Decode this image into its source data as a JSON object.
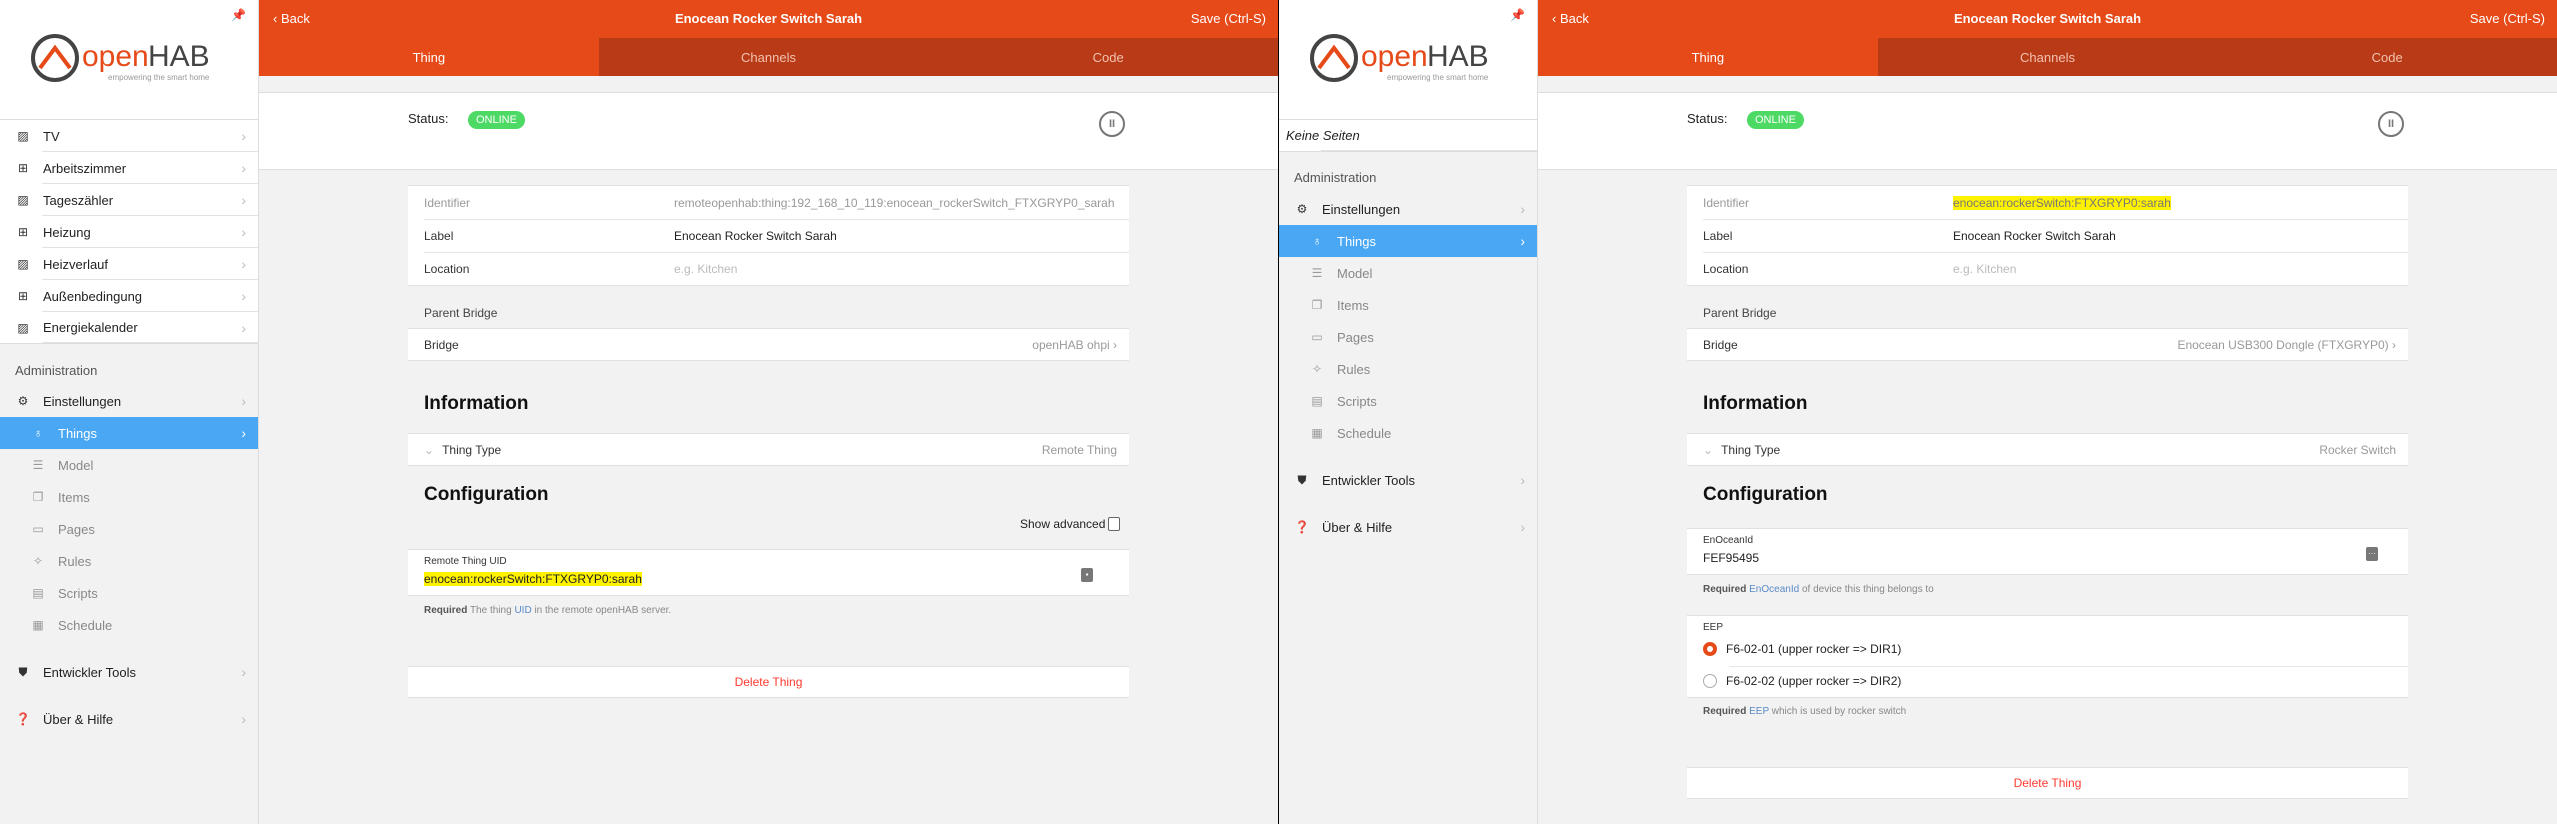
{
  "left": {
    "sidebar": {
      "items": [
        {
          "label": "TV",
          "icon": "chart-icon"
        },
        {
          "label": "Arbeitszimmer",
          "icon": "grid-icon"
        },
        {
          "label": "Tageszähler",
          "icon": "chart-icon"
        },
        {
          "label": "Heizung",
          "icon": "grid-icon"
        },
        {
          "label": "Heizverlauf",
          "icon": "chart-icon"
        },
        {
          "label": "Außenbedingung",
          "icon": "grid-icon"
        },
        {
          "label": "Energiekalender",
          "icon": "chart-icon"
        }
      ],
      "admin_heading": "Administration",
      "settings": "Einstellungen",
      "sub": [
        "Things",
        "Model",
        "Items",
        "Pages",
        "Rules",
        "Scripts",
        "Schedule"
      ],
      "dev_tools": "Entwickler Tools",
      "help": "Über & Hilfe"
    },
    "header": {
      "back": "Back",
      "title": "Enocean Rocker Switch Sarah",
      "save": "Save (Ctrl-S)"
    },
    "tabs": [
      "Thing",
      "Channels",
      "Code"
    ],
    "status": {
      "label": "Status:",
      "value": "ONLINE"
    },
    "fields": {
      "identifier_label": "Identifier",
      "identifier": "remoteopenhab:thing:192_168_10_119:enocean_rockerSwitch_FTXGRYP0_sarah",
      "label_label": "Label",
      "label": "Enocean Rocker Switch Sarah",
      "location_label": "Location",
      "location_placeholder": "e.g. Kitchen"
    },
    "parent_bridge": {
      "heading": "Parent Bridge",
      "label": "Bridge",
      "value": "openHAB ohpi"
    },
    "information": {
      "heading": "Information",
      "thing_type_label": "Thing Type",
      "thing_type": "Remote Thing"
    },
    "configuration": {
      "heading": "Configuration",
      "show_advanced": "Show advanced",
      "field_label": "Remote Thing UID",
      "field_value": "enocean:rockerSwitch:FTXGRYP0:sarah",
      "hint_required": "Required",
      "hint_1": "The thing ",
      "hint_link": "UID",
      "hint_2": " in the remote openHAB server."
    },
    "delete": "Delete Thing"
  },
  "right": {
    "sidebar": {
      "no_pages": "Keine Seiten",
      "admin_heading": "Administration",
      "settings": "Einstellungen",
      "sub": [
        "Things",
        "Model",
        "Items",
        "Pages",
        "Rules",
        "Scripts",
        "Schedule"
      ],
      "dev_tools": "Entwickler Tools",
      "help": "Über & Hilfe"
    },
    "header": {
      "back": "Back",
      "title": "Enocean Rocker Switch Sarah",
      "save": "Save (Ctrl-S)"
    },
    "tabs": [
      "Thing",
      "Channels",
      "Code"
    ],
    "status": {
      "label": "Status:",
      "value": "ONLINE"
    },
    "fields": {
      "identifier_label": "Identifier",
      "identifier": "enocean:rockerSwitch:FTXGRYP0:sarah",
      "label_label": "Label",
      "label": "Enocean Rocker Switch Sarah",
      "location_label": "Location",
      "location_placeholder": "e.g. Kitchen"
    },
    "parent_bridge": {
      "heading": "Parent Bridge",
      "label": "Bridge",
      "value": "Enocean USB300 Dongle (FTXGRYP0)"
    },
    "information": {
      "heading": "Information",
      "thing_type_label": "Thing Type",
      "thing_type": "Rocker Switch"
    },
    "configuration": {
      "heading": "Configuration",
      "enocean_label": "EnOceanId",
      "enocean_value": "FEF95495",
      "enocean_hint_required": "Required",
      "enocean_hint_link": "EnOceanId",
      "enocean_hint": " of device this thing belongs to",
      "eep_label": "EEP",
      "eep_options": [
        "F6-02-01 (upper rocker => DIR1)",
        "F6-02-02 (upper rocker => DIR2)"
      ],
      "eep_selected": 0,
      "eep_hint_required": "Required",
      "eep_hint_link": "EEP",
      "eep_hint": " which is used by rocker switch"
    },
    "delete": "Delete Thing"
  },
  "colors": {
    "accent": "#e64a19",
    "tab_bar": "#b83a16",
    "active_nav": "#4aa7f4",
    "online": "#4cd964",
    "delete": "#ff3b30",
    "highlight": "#fff200"
  }
}
